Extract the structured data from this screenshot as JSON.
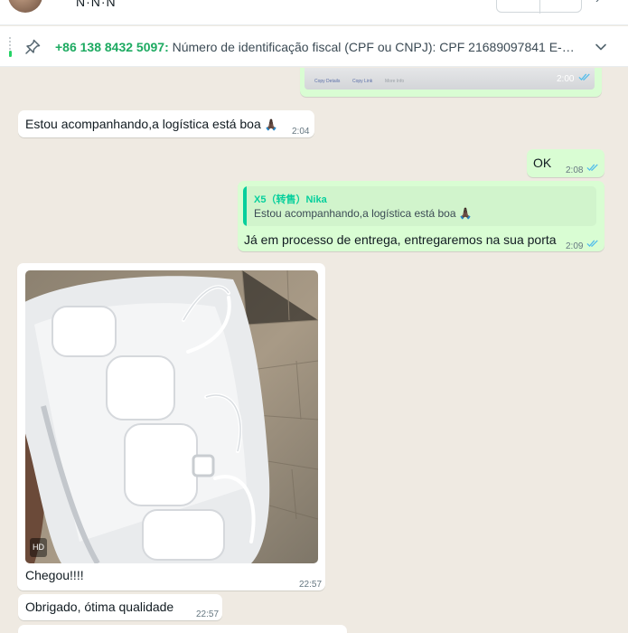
{
  "header": {
    "contact_name": "N·N·N",
    "icons": [
      "avatar",
      "video-call-icon",
      "search-icon",
      "chevron-right-icon"
    ]
  },
  "pinned": {
    "sender": "+86 138 8432 5097:",
    "text": "Número de identificação fiscal (CPF ou CNPJ): CPF 21689097841 E-mail...",
    "icons": [
      "pin-icon",
      "chevron-down-icon"
    ]
  },
  "messages": {
    "screenshot": {
      "links": [
        "Copy Details",
        "Copy Link",
        "More Info"
      ],
      "time": "2:00"
    },
    "m1": {
      "text": "Estou acompanhando,a logística está boa",
      "emoji": "🙏🏿",
      "time": "2:04"
    },
    "m2": {
      "text": "OK",
      "time": "2:08"
    },
    "m3": {
      "quote_author": "X5（转售）Nika",
      "quote_text": "Estou acompanhando,a logística está boa",
      "text": "Já em processo de entrega, entregaremos na sua porta",
      "time": "2:09"
    },
    "m4": {
      "badge": "HD",
      "caption": "Chegou!!!!",
      "time": "22:57"
    },
    "m5": {
      "text": "Obrigado, ótima qualidade",
      "time": "22:57"
    }
  },
  "colors": {
    "chat_bg": "#efeae2",
    "incoming": "#ffffff",
    "outgoing": "#d9fdd3",
    "accent_green": "#1daa61",
    "read_ticks": "#53bdeb"
  }
}
